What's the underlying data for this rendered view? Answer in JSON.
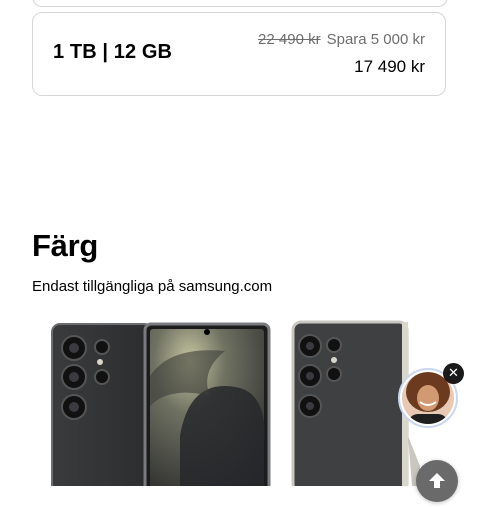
{
  "storage_option": {
    "label": "1 TB | 12 GB",
    "original_price": "22 490 kr",
    "savings": "Spara 5 000 kr",
    "price": "17 490 kr"
  },
  "color_section": {
    "title": "Färg",
    "subtitle": "Endast tillgängliga på samsung.com"
  },
  "icons": {
    "close": "close-icon",
    "scroll_top": "arrow-up-icon"
  }
}
